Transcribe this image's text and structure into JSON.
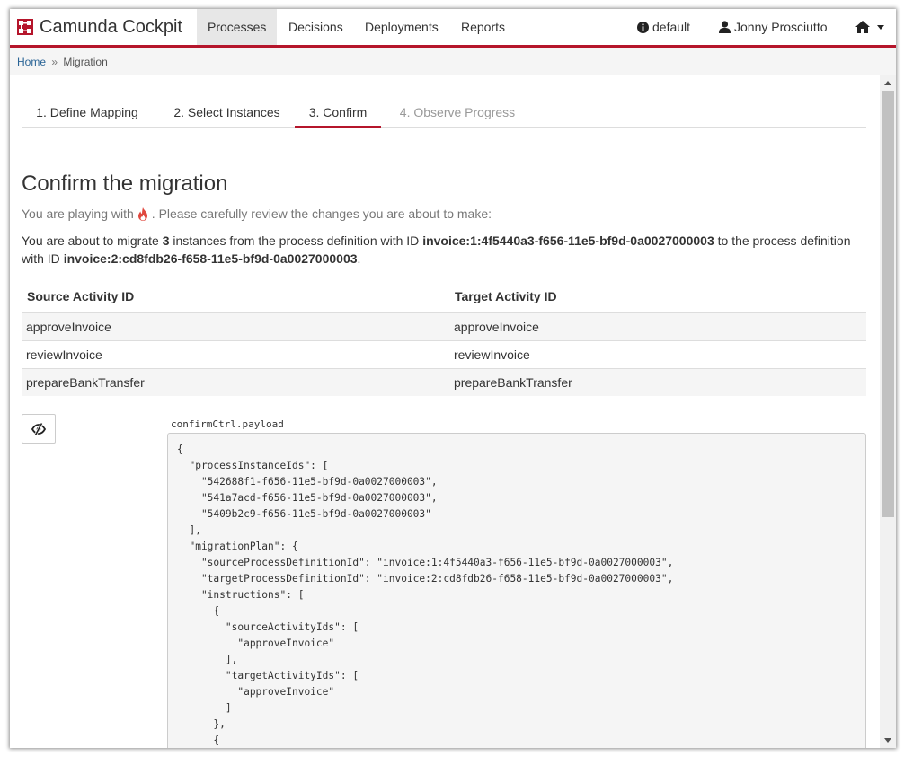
{
  "navbar": {
    "brand": "Camunda Cockpit",
    "items": [
      "Processes",
      "Decisions",
      "Deployments",
      "Reports"
    ],
    "active_item": "Processes",
    "engine": "default",
    "user": "Jonny Prosciutto",
    "home_icon": "home-icon",
    "accent_color": "#b5152b"
  },
  "breadcrumb": {
    "home": "Home",
    "separator": "»",
    "current": "Migration"
  },
  "steps": [
    {
      "label": "1. Define Mapping",
      "state": "done"
    },
    {
      "label": "2. Select Instances",
      "state": "done"
    },
    {
      "label": "3. Confirm",
      "state": "active"
    },
    {
      "label": "4. Observe Progress",
      "state": "disabled"
    }
  ],
  "confirm": {
    "title": "Confirm the migration",
    "intro_before": "You are playing with",
    "intro_icon": "fire-icon",
    "intro_after": ". Please carefully review the changes you are about to make:",
    "desc_1": "You are about to migrate ",
    "instance_count": "3",
    "desc_2": " instances from the process definition with ID ",
    "source_id": "invoice:1:4f5440a3-f656-11e5-bf9d-0a0027000003",
    "desc_3": " to the process definition with ID ",
    "target_id": "invoice:2:cd8fdb26-f658-11e5-bf9d-0a0027000003",
    "desc_4": "."
  },
  "mapping_table": {
    "headers": [
      "Source Activity ID",
      "Target Activity ID"
    ],
    "rows": [
      [
        "approveInvoice",
        "approveInvoice"
      ],
      [
        "reviewInvoice",
        "reviewInvoice"
      ],
      [
        "prepareBankTransfer",
        "prepareBankTransfer"
      ]
    ]
  },
  "payload": {
    "toggle_icon": "eye-slash-icon",
    "label": "confirmCtrl.payload",
    "text": "{\n  \"processInstanceIds\": [\n    \"542688f1-f656-11e5-bf9d-0a0027000003\",\n    \"541a7acd-f656-11e5-bf9d-0a0027000003\",\n    \"5409b2c9-f656-11e5-bf9d-0a0027000003\"\n  ],\n  \"migrationPlan\": {\n    \"sourceProcessDefinitionId\": \"invoice:1:4f5440a3-f656-11e5-bf9d-0a0027000003\",\n    \"targetProcessDefinitionId\": \"invoice:2:cd8fdb26-f658-11e5-bf9d-0a0027000003\",\n    \"instructions\": [\n      {\n        \"sourceActivityIds\": [\n          \"approveInvoice\"\n        ],\n        \"targetActivityIds\": [\n          \"approveInvoice\"\n        ]\n      },\n      {\n        \"sourceActivityIds\": ["
  }
}
